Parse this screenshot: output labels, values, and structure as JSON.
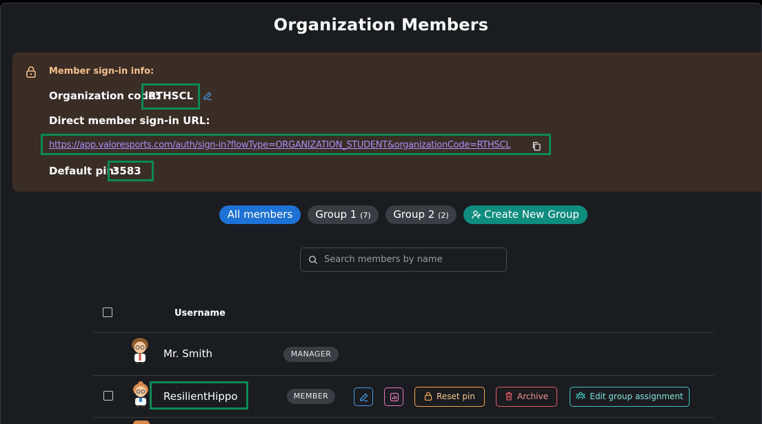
{
  "page": {
    "title": "Organization Members"
  },
  "signin_info": {
    "heading": "Member sign-in info:",
    "org_code_label": "Organization code:",
    "org_code": "RTHSCL",
    "direct_url_label": "Direct member sign-in URL:",
    "direct_url": "https://app.valoresports.com/auth/sign-in?flowType=ORGANIZATION_STUDENT&organizationCode=RTHSCL",
    "default_pin_label": "Default pin:",
    "default_pin": "3583"
  },
  "filters": {
    "all_members": "All members",
    "groups": [
      {
        "label": "Group 1",
        "count": "(7)"
      },
      {
        "label": "Group 2",
        "count": "(2)"
      }
    ],
    "create_group": "Create New Group"
  },
  "search": {
    "placeholder": "Search members by name",
    "value": ""
  },
  "table": {
    "column_username": "Username",
    "rows": [
      {
        "name": "Mr. Smith",
        "role": "MANAGER"
      },
      {
        "name": "ResilientHippo",
        "role": "MEMBER"
      }
    ],
    "row_actions": {
      "reset_pin": "Reset pin",
      "archive": "Archive",
      "edit_group": "Edit group assignment"
    }
  },
  "colors": {
    "panel_bg": "#3a2d26",
    "heading_accent": "#f4c08e",
    "highlight_box": "#0b8a56",
    "link": "#a98ff5",
    "primary_chip": "#1e72d6",
    "create_chip": "#0e8c7e"
  },
  "icons": [
    "lock-icon",
    "edit-icon",
    "copy-icon",
    "add-user-icon",
    "search-icon",
    "bar-chart-icon",
    "trash-icon",
    "group-icon"
  ]
}
